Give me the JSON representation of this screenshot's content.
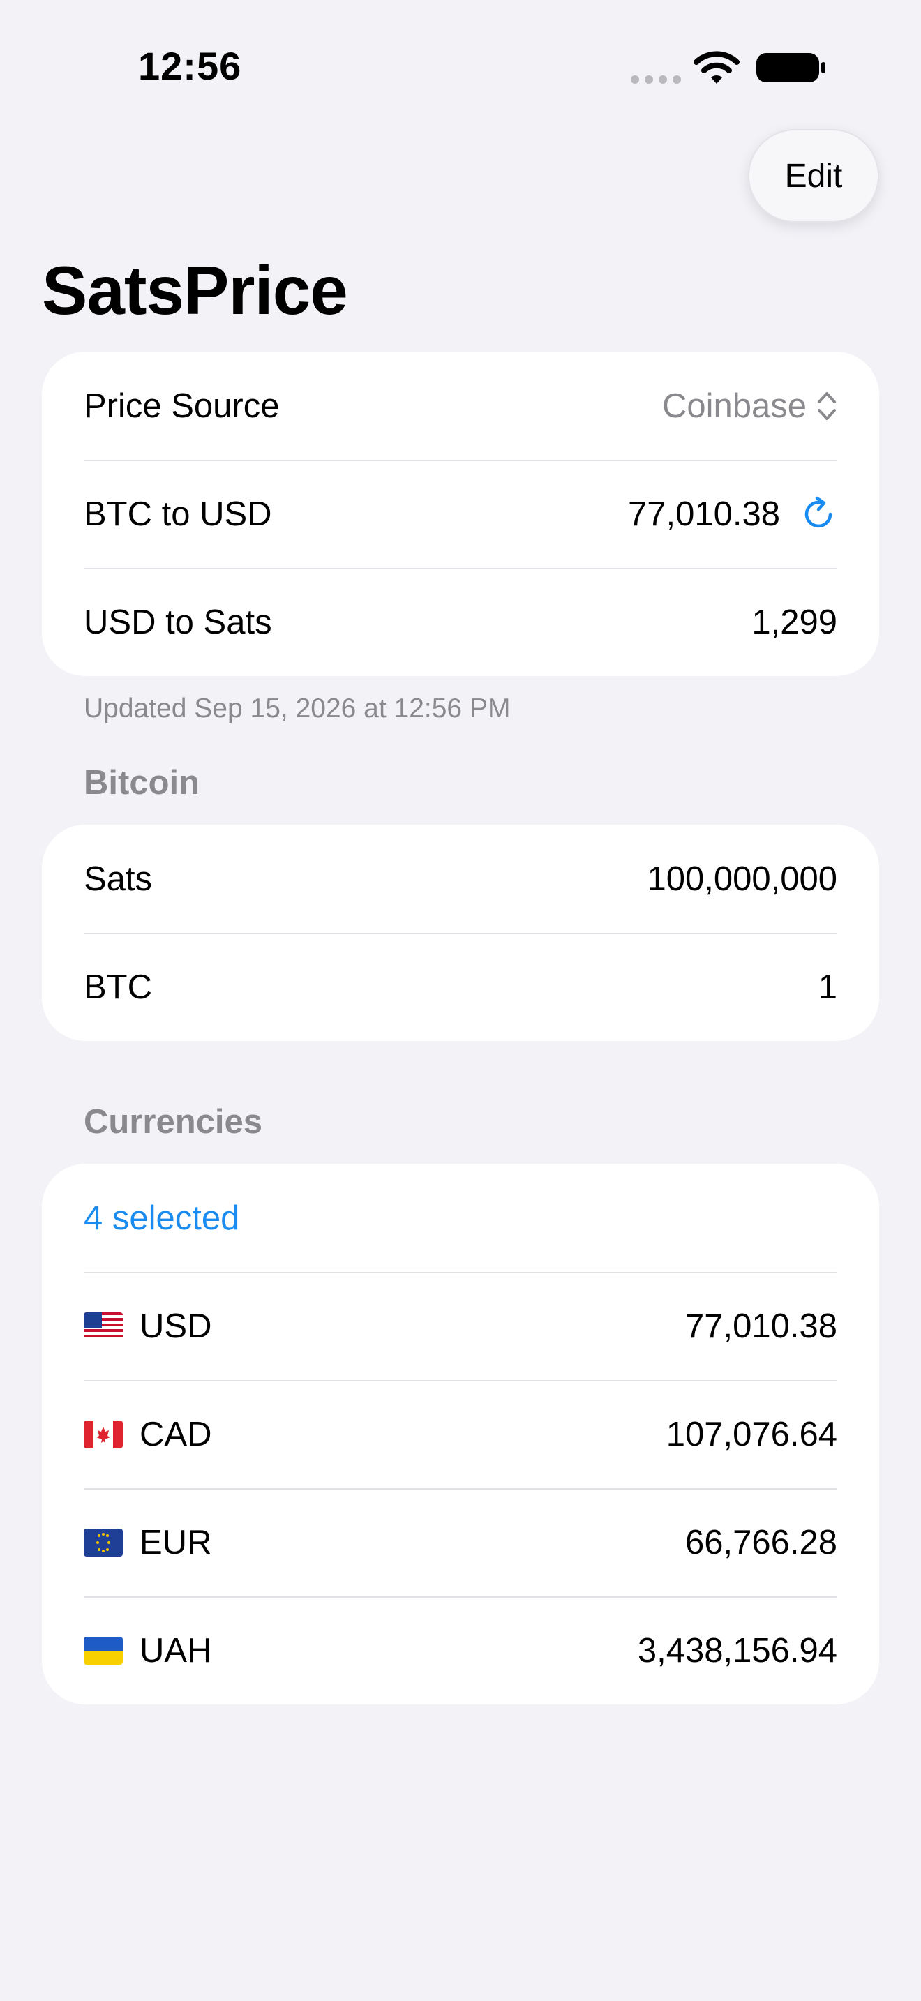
{
  "status_bar": {
    "time": "12:56"
  },
  "nav": {
    "edit_label": "Edit",
    "title": "SatsPrice"
  },
  "price_card": {
    "source_label": "Price Source",
    "source_value": "Coinbase",
    "btc_usd_label": "BTC to USD",
    "btc_usd_value": "77,010.38",
    "usd_sats_label": "USD to Sats",
    "usd_sats_value": "1,299"
  },
  "updated_text": "Updated Sep 15, 2026 at 12:56 PM",
  "bitcoin": {
    "header": "Bitcoin",
    "sats_label": "Sats",
    "sats_value": "100,000,000",
    "btc_label": "BTC",
    "btc_value": "1"
  },
  "currencies": {
    "header": "Currencies",
    "selected_label": "4 selected",
    "items": [
      {
        "code": "USD",
        "value": "77,010.38",
        "flag": "us-flag"
      },
      {
        "code": "CAD",
        "value": "107,076.64",
        "flag": "ca-flag"
      },
      {
        "code": "EUR",
        "value": "66,766.28",
        "flag": "eu-flag"
      },
      {
        "code": "UAH",
        "value": "3,438,156.94",
        "flag": "ua-flag"
      }
    ]
  },
  "colors": {
    "accent": "#1a8cf0",
    "background": "#f2f2f7",
    "secondary_text": "#8a8a8e"
  },
  "icons": [
    "wifi-icon",
    "battery-icon",
    "chevron-updown-icon",
    "refresh-icon"
  ]
}
